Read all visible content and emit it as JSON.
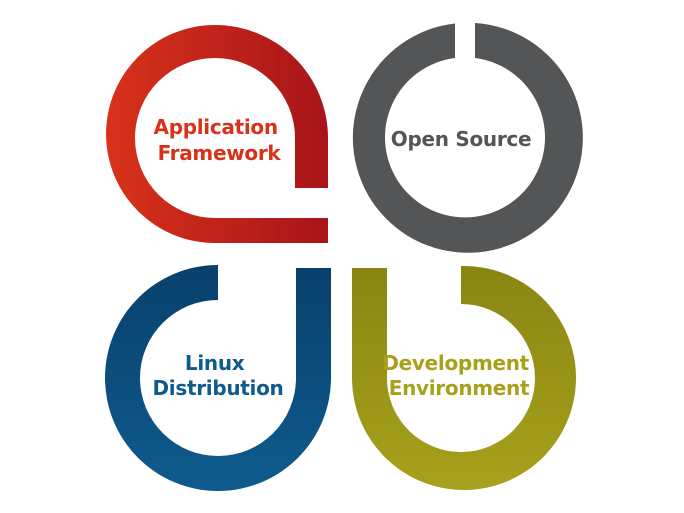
{
  "diagram": {
    "quadrants": [
      {
        "id": "application-framework",
        "lines": [
          "Application",
          "Framework"
        ],
        "color": "#d8321a",
        "tail_color": "#a8141a"
      },
      {
        "id": "open-source",
        "lines": [
          "Open Source"
        ],
        "color": "#545556",
        "tail_color": "#545556"
      },
      {
        "id": "linux-distribution",
        "lines": [
          "Linux",
          "Distribution"
        ],
        "color": "#0f5b8e",
        "tail_color": "#08406c"
      },
      {
        "id": "development-environment",
        "lines": [
          "Development",
          "Environment"
        ],
        "color": "#a7a11c",
        "tail_color": "#8a8512"
      }
    ]
  }
}
